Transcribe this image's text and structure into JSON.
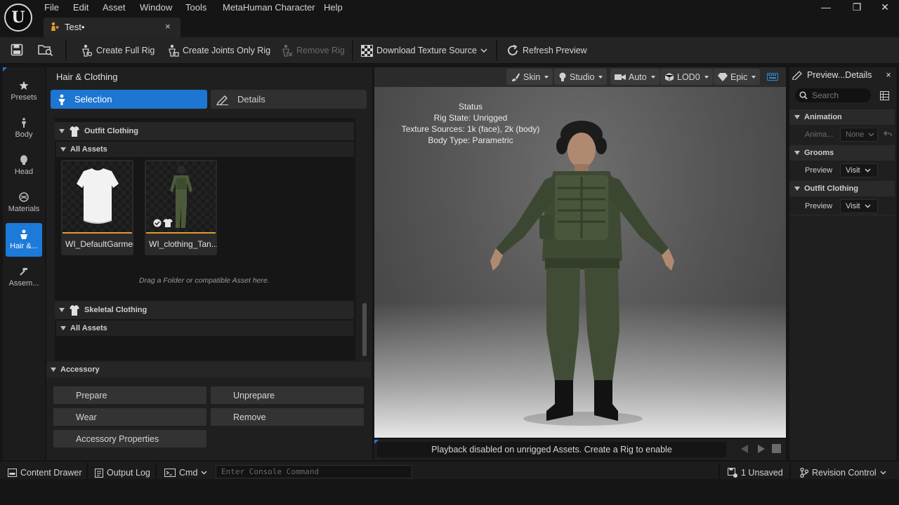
{
  "menu": [
    "File",
    "Edit",
    "Asset",
    "Window",
    "Tools",
    "MetaHuman Character",
    "Help"
  ],
  "document_tab": {
    "label": "Test•",
    "close": "×"
  },
  "window_controls": {
    "minimize": "—",
    "restore": "❐",
    "close": "✕"
  },
  "toolbar": {
    "create_full_rig": "Create Full Rig",
    "create_joints_only_rig": "Create Joints Only Rig",
    "remove_rig": "Remove Rig",
    "download_texture_source": "Download Texture Source",
    "refresh_preview": "Refresh Preview"
  },
  "left_nav": [
    {
      "label": "Presets",
      "icon": "star-icon"
    },
    {
      "label": "Body",
      "icon": "body-icon"
    },
    {
      "label": "Head",
      "icon": "head-icon"
    },
    {
      "label": "Materials",
      "icon": "materials-icon"
    },
    {
      "label": "Hair &...",
      "icon": "hair-clothing-icon",
      "active": true
    },
    {
      "label": "Assem...",
      "icon": "hammer-icon"
    }
  ],
  "hair_clothing": {
    "title": "Hair & Clothing",
    "tabs": {
      "selection": "Selection",
      "details": "Details"
    },
    "outfit_clothing": {
      "title": "Outfit Clothing",
      "sub_title": "All Assets",
      "assets": [
        "WI_DefaultGarment",
        "WI_clothing_Tan..."
      ],
      "drop_hint": "Drag a Folder or compatible Asset here."
    },
    "skeletal_clothing": {
      "title": "Skeletal Clothing",
      "sub_title": "All Assets"
    },
    "accessory": {
      "title": "Accessory",
      "buttons": {
        "prepare": "Prepare",
        "unprepare": "Unprepare",
        "wear": "Wear",
        "remove": "Remove",
        "properties": "Accessory Properties"
      }
    }
  },
  "viewport": {
    "toolbar": {
      "skin": "Skin",
      "studio": "Studio",
      "auto": "Auto",
      "lod": "LOD0",
      "quality": "Epic"
    },
    "status": {
      "title": "Status",
      "rig_state": "Rig State: Unrigged",
      "texture_sources": "Texture Sources: 1k (face), 2k (body)",
      "body_type": "Body Type: Parametric"
    },
    "playback_message": "Playback disabled on unrigged Assets. Create a Rig to enable"
  },
  "details_panel": {
    "tab_label": "Preview...Details",
    "close": "×",
    "search_placeholder": "Search",
    "sections": {
      "animation": {
        "title": "Animation",
        "label": "Anima...",
        "value": "None"
      },
      "grooms": {
        "title": "Grooms",
        "label": "Preview",
        "value": "Visit"
      },
      "outfit_clothing": {
        "title": "Outfit Clothing",
        "label": "Preview",
        "value": "Visit"
      }
    }
  },
  "bottom_bar": {
    "content_drawer": "Content Drawer",
    "output_log": "Output Log",
    "cmd": "Cmd",
    "console_placeholder": "Enter Console Command",
    "unsaved": "1 Unsaved",
    "revision_control": "Revision Control"
  },
  "colors": {
    "accent": "#1d76d2",
    "asset_bar": "#e39b28",
    "panel": "#1f1f1f",
    "background": "#151515"
  }
}
